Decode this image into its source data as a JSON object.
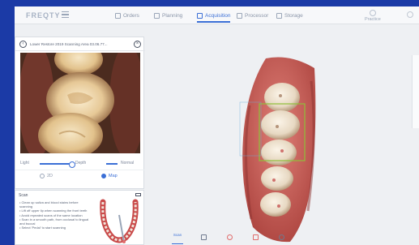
{
  "app": {
    "brand": "FREQTY"
  },
  "nav": {
    "items": [
      {
        "label": "Orders",
        "icon": "orders-icon"
      },
      {
        "label": "Planning",
        "icon": "planning-icon"
      },
      {
        "label": "Acquisition",
        "icon": "acquisition-icon",
        "active": true
      },
      {
        "label": "Processor",
        "icon": "processor-icon"
      },
      {
        "label": "Storage",
        "icon": "storage-icon"
      }
    ],
    "user_label": "Practice"
  },
  "camera": {
    "title": "Lower Restore 2019 Scanning Area 03.06.77...",
    "light_label": "Light",
    "light_level": 0.85,
    "depth_label": "Depth",
    "normal_label": "Normal",
    "mode_left": "2D",
    "mode_right": "Map",
    "mode_selected": "Map"
  },
  "tips": {
    "heading": "Scan",
    "items": [
      "• Clean up saliva and blood stains before scanning",
      "• Lift off upper lip when scanning the front teeth",
      "• Avoid repeated scans of the same location",
      "• Scan in a smooth path, from occlusal to lingual and buccal",
      "• Select 'Pedal' to start scanning"
    ]
  },
  "bottom": {
    "active_label": "Scan"
  },
  "colors": {
    "accent": "#3b6fd6",
    "bezel": "#1b3aa6",
    "gum": "#c75a55",
    "tooth": "#eadfcf"
  }
}
